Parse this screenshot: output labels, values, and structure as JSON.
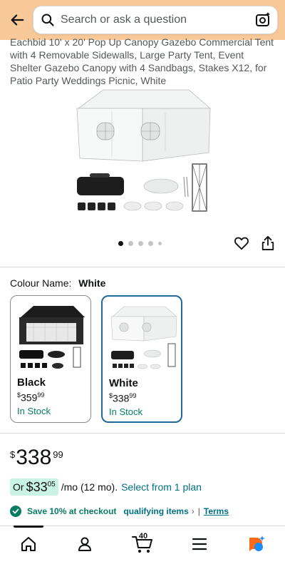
{
  "search": {
    "placeholder": "Search or ask a question"
  },
  "product": {
    "title": "Eachbid 10' x 20' Pop Up Canopy Gazebo Commercial Tent with 4 Removable Sidewalls, Large Party Tent, Event Shelter Gazebo Canopy with 4 Sandbags, Stakes X12, for Patio Party Weddings Picnic, White"
  },
  "carousel": {
    "total": 5,
    "active": 1
  },
  "colour": {
    "label": "Colour Name:",
    "selected": "White",
    "options": [
      {
        "name": "Black",
        "currency": "$",
        "whole": "359",
        "fraction": "99",
        "stock": "In Stock"
      },
      {
        "name": "White",
        "currency": "$",
        "whole": "338",
        "fraction": "99",
        "stock": "In Stock"
      }
    ]
  },
  "price": {
    "currency": "$",
    "whole": "338",
    "fraction": "99"
  },
  "monthly": {
    "prefix": "Or",
    "currency": "$",
    "whole": "33",
    "fraction": "05",
    "per": "/mo (12 mo).",
    "link": "Select from 1 plan"
  },
  "coupon": {
    "save": "Save 10% at checkout",
    "qualifying": "qualifying items",
    "chevron": "›",
    "separator": "|",
    "terms": "Terms"
  },
  "nav": {
    "cart_count": "40"
  },
  "colors": {
    "header": "#f7c898",
    "link": "#007185",
    "success": "#067d62",
    "selected_border": "#1f6a99"
  }
}
